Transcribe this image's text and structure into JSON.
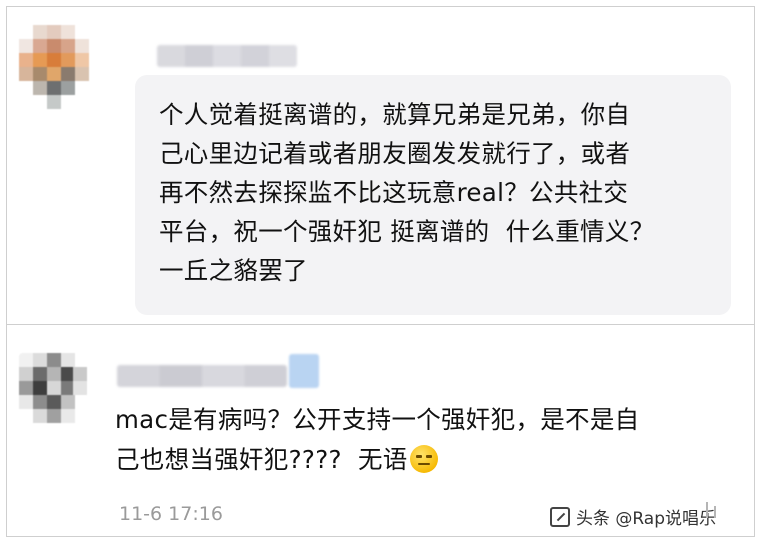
{
  "comment1": {
    "text": "个人觉着挺离谱的，就算兄弟是兄弟，你自\n己心里边记着或者朋友圈发发就行了，或者\n再不然去探探监不比这玩意real？公共社交\n平台，祝一个强奸犯 挺离谱的  什么重情义？\n一丘之貉罢了"
  },
  "comment2": {
    "text": "mac是有病吗？公开支持一个强奸犯，是不是自\n己也想当强奸犯????  无语",
    "emoji": "expressionless-face",
    "timestamp": "11-6 17:16"
  },
  "watermark": {
    "label": "头条 @Rap说唱乐"
  },
  "colors": {
    "bubble": "#f3f3f5",
    "text": "#111111",
    "timestamp": "#9a9a9a",
    "divider": "#cfcfcf"
  }
}
